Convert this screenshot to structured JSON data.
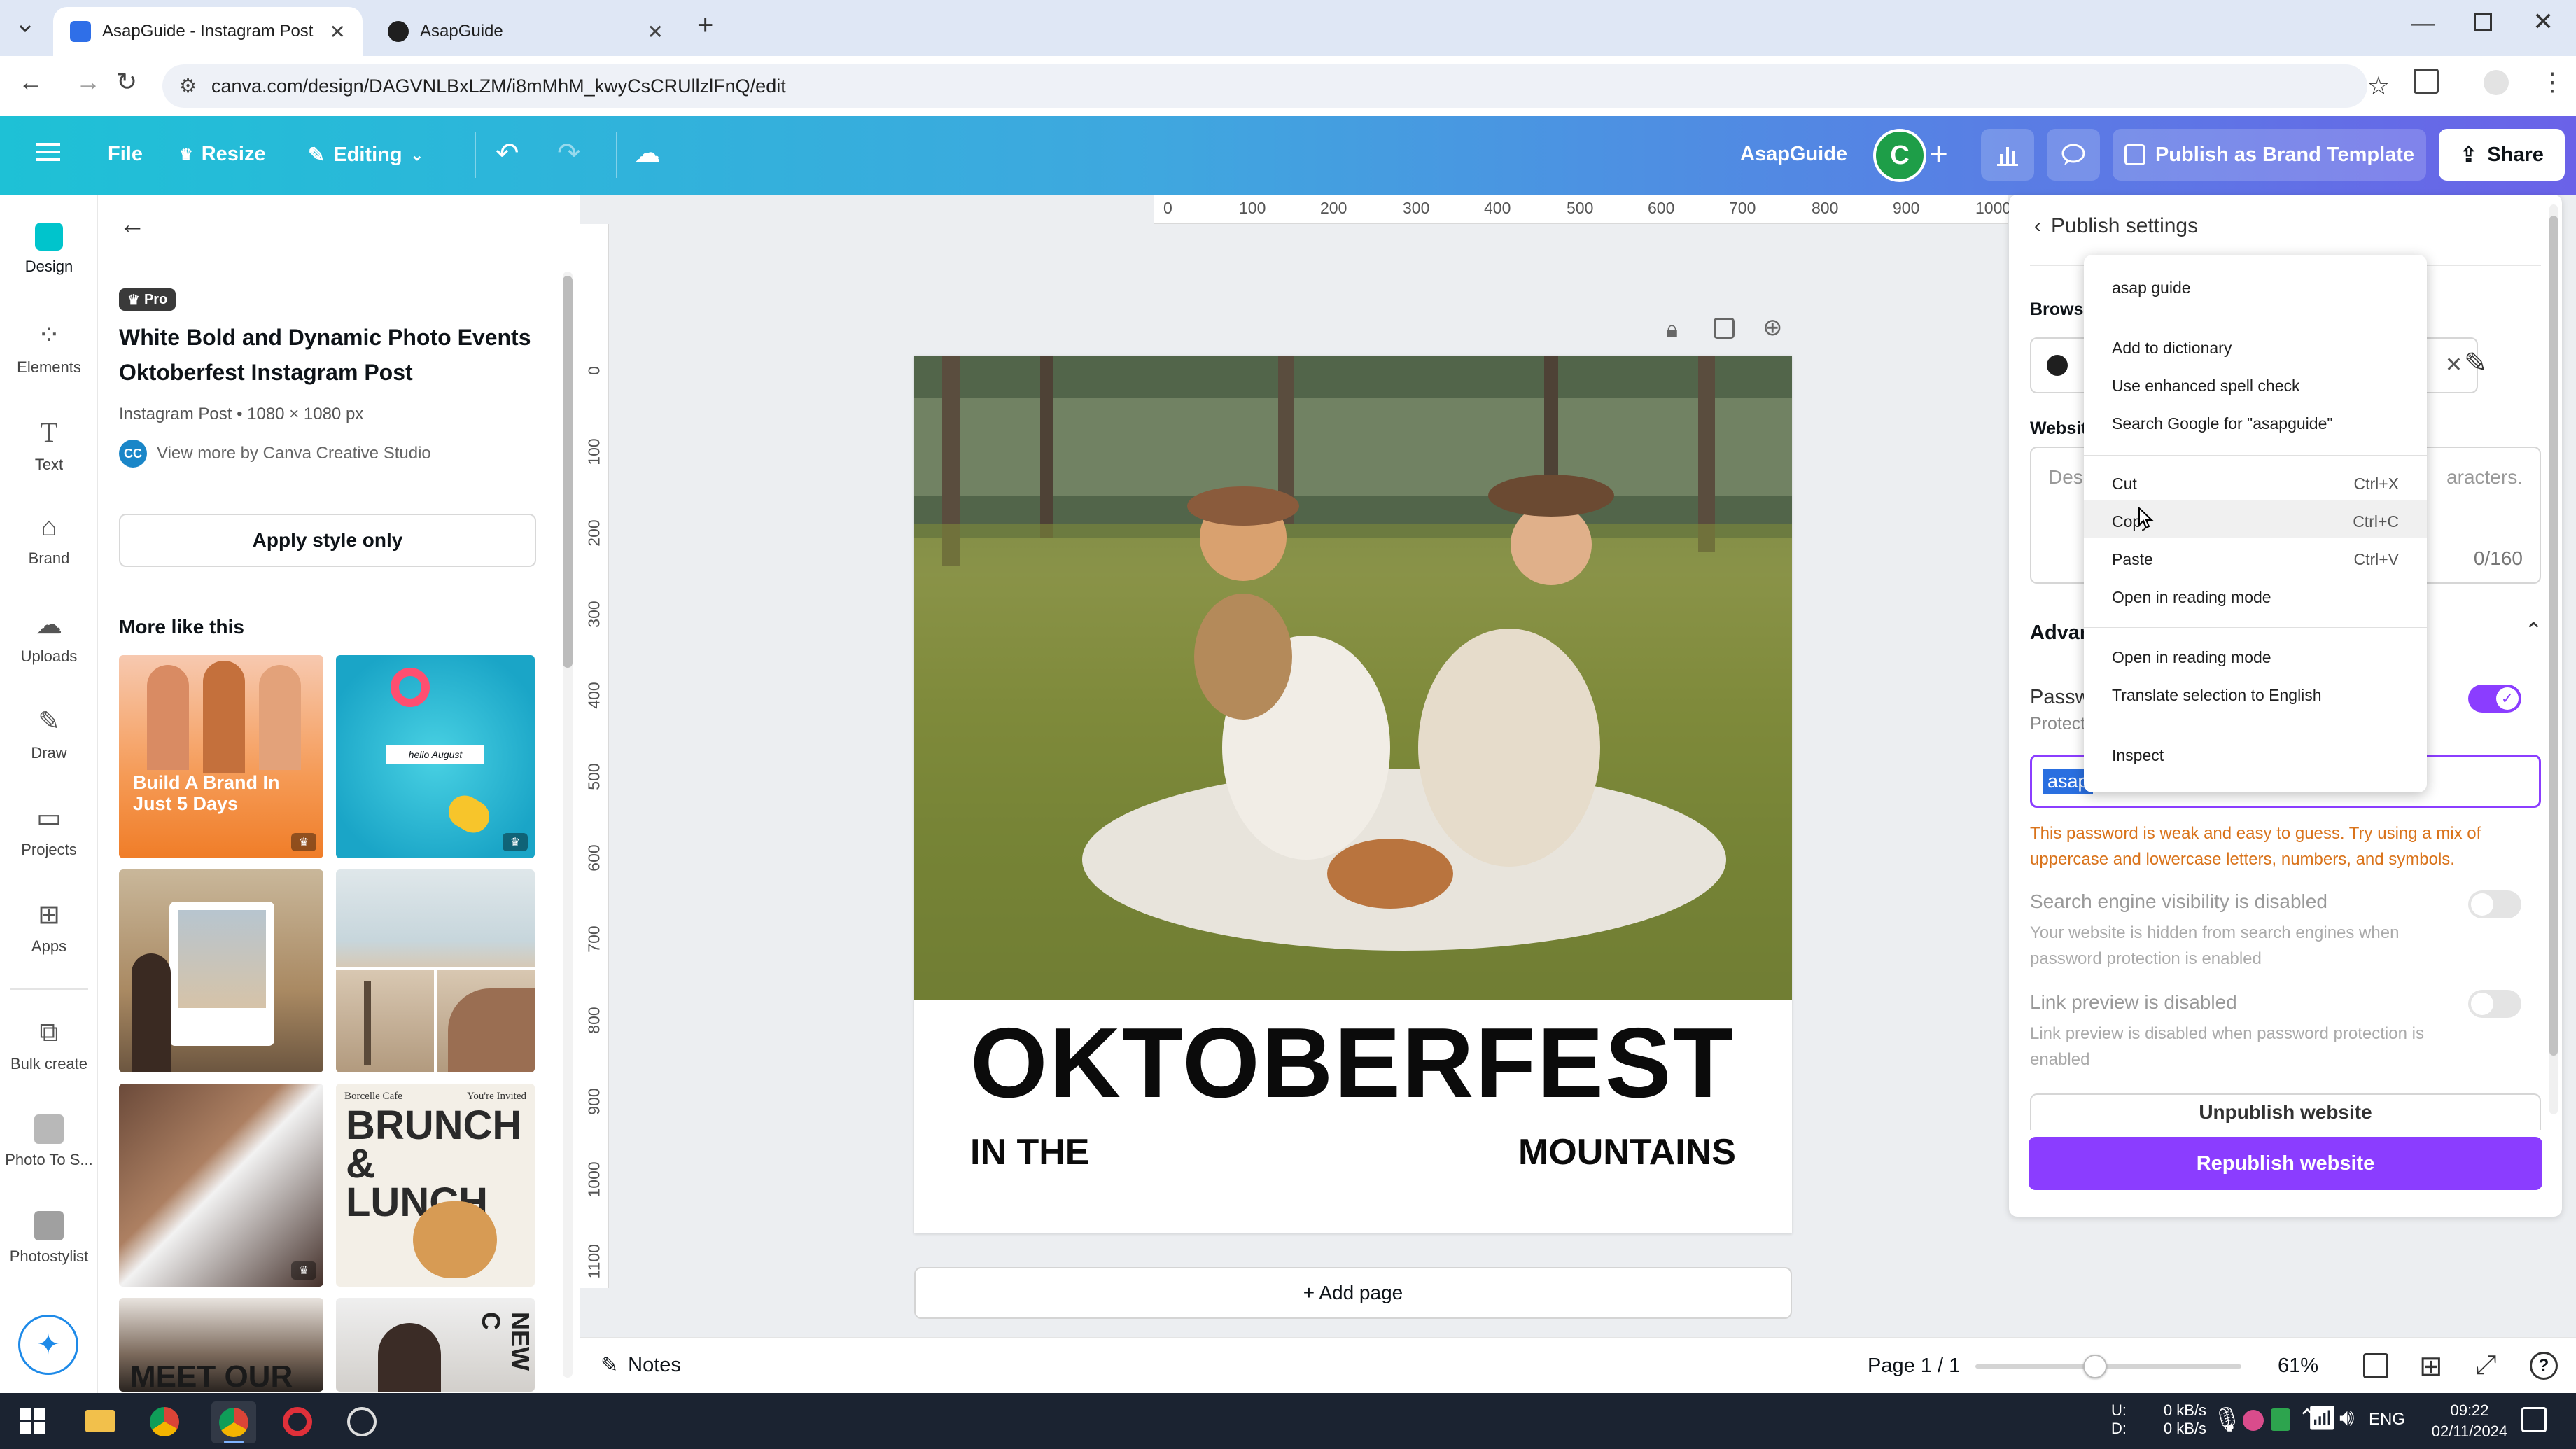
{
  "browser": {
    "tabs": [
      {
        "title": "AsapGuide - Instagram Post",
        "active": true
      },
      {
        "title": "AsapGuide",
        "active": false
      }
    ],
    "url": "canva.com/design/DAGVNLBxLZM/i8mMhM_kwyCsCRUllzlFnQ/edit"
  },
  "toolbar": {
    "file": "File",
    "resize": "Resize",
    "editing": "Editing",
    "project_name": "AsapGuide",
    "avatar_letter": "C",
    "publish_brand": "Publish as Brand Template",
    "share": "Share"
  },
  "rail": [
    {
      "label": "Design",
      "icon": "design-icon"
    },
    {
      "label": "Elements",
      "icon": "elements-icon"
    },
    {
      "label": "Text",
      "icon": "text-icon"
    },
    {
      "label": "Brand",
      "icon": "brand-icon"
    },
    {
      "label": "Uploads",
      "icon": "uploads-icon"
    },
    {
      "label": "Draw",
      "icon": "draw-icon"
    },
    {
      "label": "Projects",
      "icon": "projects-icon"
    },
    {
      "label": "Apps",
      "icon": "apps-icon"
    },
    {
      "label": "Bulk create",
      "icon": "bulk-create-icon"
    },
    {
      "label": "Photo To S...",
      "icon": "photo-to-sketch-icon"
    },
    {
      "label": "Photostylist",
      "icon": "photostylist-icon"
    }
  ],
  "panel": {
    "badge": "Pro",
    "title_line1": "White Bold and Dynamic Photo Events",
    "title_line2": "Oktoberfest Instagram Post",
    "meta": "Instagram Post • 1080 × 1080 px",
    "creator_initials": "CC",
    "creator": "View more by Canva Creative Studio",
    "apply_style": "Apply style only",
    "more_like": "More like this",
    "thumb_texts": {
      "t1": "Build A Brand In Just 5 Days",
      "t2": "hello August",
      "t6a": "Borcelle Cafe",
      "t6b": "You're Invited",
      "t6c": "BRUNCH & LUNCH",
      "t7": "MEET OUR",
      "t8": "NEW C"
    }
  },
  "rulers": {
    "top": [
      "0",
      "100",
      "200",
      "300",
      "400",
      "500",
      "600",
      "700",
      "800",
      "900",
      "1000"
    ],
    "left": [
      "0",
      "100",
      "200",
      "300",
      "400",
      "500",
      "600",
      "700",
      "800",
      "900",
      "1000",
      "1100"
    ]
  },
  "design": {
    "headline": "OKTOBERFEST",
    "sub_left": "IN THE",
    "sub_right": "MOUNTAINS",
    "add_page": "+ Add page"
  },
  "publish": {
    "header": "Publish settings",
    "browser_label": "Browse",
    "website_label": "Website",
    "desc_placeholder": "Desc",
    "desc_suffix": "aracters.",
    "desc_counter": "0/160",
    "advanced_label": "Advan",
    "password_label": "Passw",
    "protect_label": "Protect",
    "password_value": "asap",
    "warning": "This password is weak and easy to guess. Try using a mix of uppercase and lowercase letters, numbers, and symbols.",
    "search_title": "Search engine visibility is disabled",
    "search_desc": "Your website is hidden from search engines when password protection is enabled",
    "link_title": "Link preview is disabled",
    "link_desc": "Link preview is disabled when password protection is enabled",
    "unpublish": "Unpublish website",
    "republish": "Republish website"
  },
  "context_menu": {
    "suggestion": "asap guide",
    "add_dictionary": "Add to dictionary",
    "enhanced": "Use enhanced spell check",
    "search_google": "Search Google for \"asapguide\"",
    "cut": "Cut",
    "cut_sc": "Ctrl+X",
    "copy": "Copy",
    "copy_sc": "Ctrl+C",
    "paste": "Paste",
    "paste_sc": "Ctrl+V",
    "reading1": "Open in reading mode",
    "reading2": "Open in reading mode",
    "translate": "Translate selection to English",
    "inspect": "Inspect"
  },
  "bottombar": {
    "notes": "Notes",
    "page": "Page 1 / 1",
    "zoom": "61%",
    "zoom_level": 0.45
  },
  "taskbar": {
    "net_up_label": "U:",
    "net_down_label": "D:",
    "net_up": "0 kB/s",
    "net_down": "0 kB/s",
    "lang": "ENG",
    "time": "09:22",
    "date": "02/11/2024"
  },
  "colors": {
    "purple": "#8b3dff",
    "teal": "#1ec1d6",
    "warning": "#d9731b",
    "avatar": "#1e9e48"
  }
}
